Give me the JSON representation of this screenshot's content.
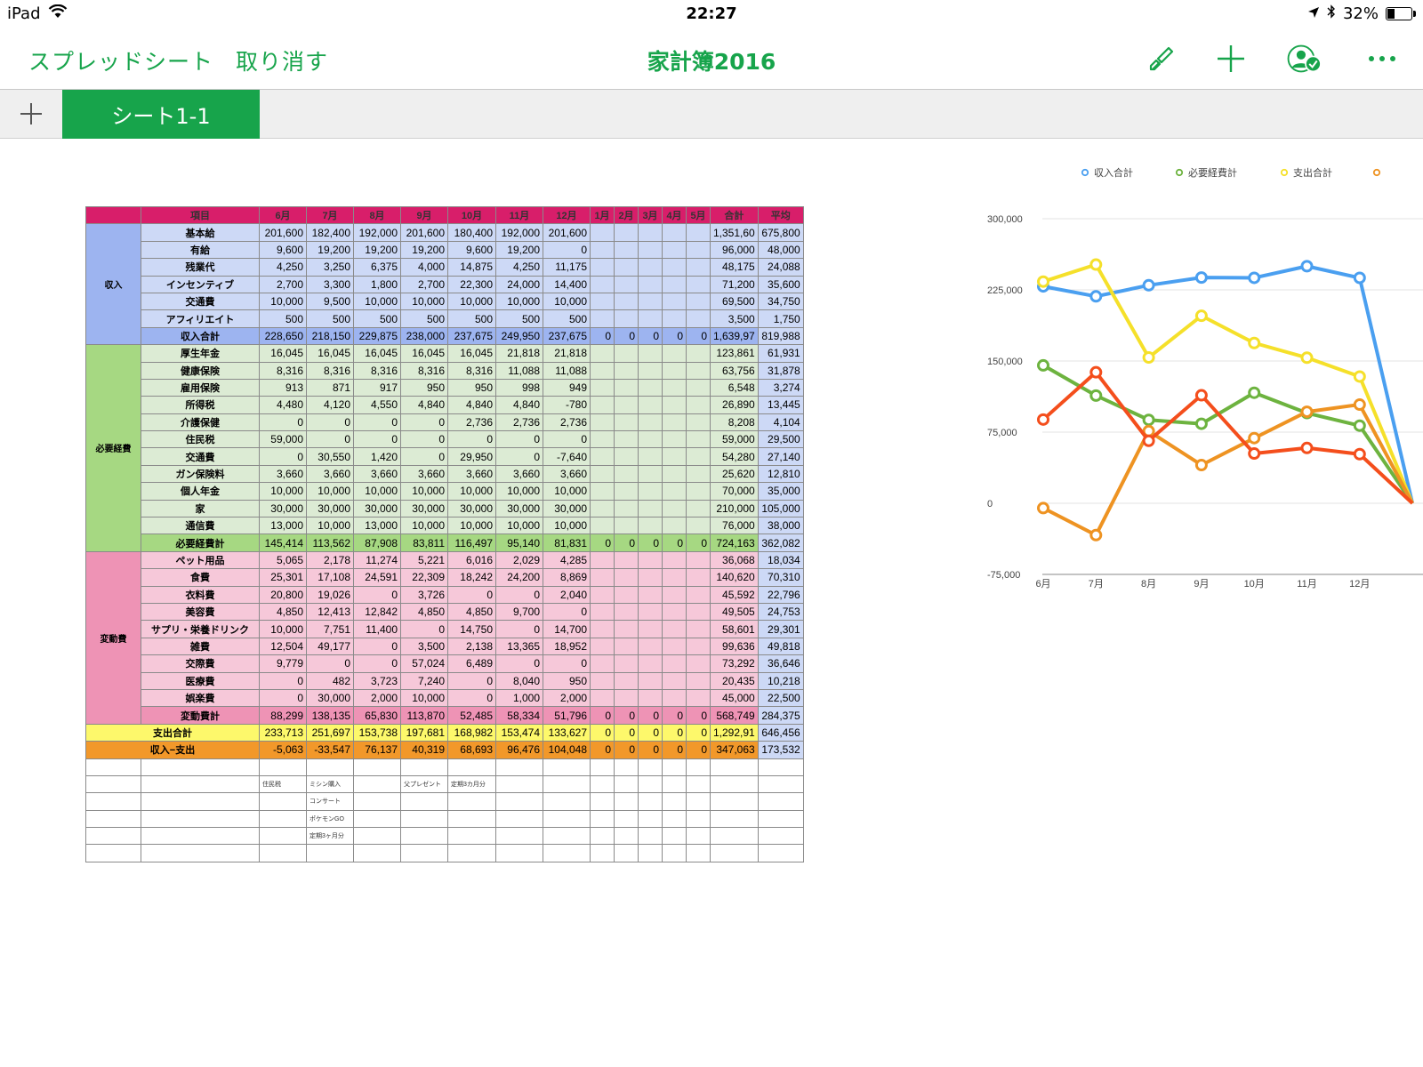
{
  "status": {
    "device": "iPad",
    "time": "22:27",
    "battery": "32%",
    "battery_level": 0.32
  },
  "toolbar": {
    "spreadsheets": "スプレッドシート",
    "undo": "取り消す",
    "title": "家計簿2016"
  },
  "tabs": [
    {
      "label": "シート1-1",
      "active": true
    }
  ],
  "sheet": {
    "headers": [
      "項目",
      "6月",
      "7月",
      "8月",
      "9月",
      "10月",
      "11月",
      "12月",
      "1月",
      "2月",
      "3月",
      "4月",
      "5月",
      "合計",
      "平均"
    ],
    "income": {
      "category": "収入",
      "rows": [
        {
          "label": "基本給",
          "values": [
            "201,600",
            "182,400",
            "192,000",
            "201,600",
            "180,400",
            "192,000",
            "201,600",
            "",
            "",
            "",
            "",
            "",
            "1,351,60",
            "675,800"
          ]
        },
        {
          "label": "有給",
          "values": [
            "9,600",
            "19,200",
            "19,200",
            "19,200",
            "9,600",
            "19,200",
            "0",
            "",
            "",
            "",
            "",
            "",
            "96,000",
            "48,000"
          ]
        },
        {
          "label": "残業代",
          "values": [
            "4,250",
            "3,250",
            "6,375",
            "4,000",
            "14,875",
            "4,250",
            "11,175",
            "",
            "",
            "",
            "",
            "",
            "48,175",
            "24,088"
          ]
        },
        {
          "label": "インセンティブ",
          "values": [
            "2,700",
            "3,300",
            "1,800",
            "2,700",
            "22,300",
            "24,000",
            "14,400",
            "",
            "",
            "",
            "",
            "",
            "71,200",
            "35,600"
          ]
        },
        {
          "label": "交通費",
          "values": [
            "10,000",
            "9,500",
            "10,000",
            "10,000",
            "10,000",
            "10,000",
            "10,000",
            "",
            "",
            "",
            "",
            "",
            "69,500",
            "34,750"
          ]
        },
        {
          "label": "アフィリエイト",
          "values": [
            "500",
            "500",
            "500",
            "500",
            "500",
            "500",
            "500",
            "",
            "",
            "",
            "",
            "",
            "3,500",
            "1,750"
          ]
        }
      ],
      "total": {
        "label": "収入合計",
        "values": [
          "228,650",
          "218,150",
          "229,875",
          "238,000",
          "237,675",
          "249,950",
          "237,675",
          "0",
          "0",
          "0",
          "0",
          "0",
          "1,639,97",
          "819,988"
        ]
      }
    },
    "necessary": {
      "category": "必要経費",
      "rows": [
        {
          "label": "厚生年金",
          "values": [
            "16,045",
            "16,045",
            "16,045",
            "16,045",
            "16,045",
            "21,818",
            "21,818",
            "",
            "",
            "",
            "",
            "",
            "123,861",
            "61,931"
          ]
        },
        {
          "label": "健康保険",
          "values": [
            "8,316",
            "8,316",
            "8,316",
            "8,316",
            "8,316",
            "11,088",
            "11,088",
            "",
            "",
            "",
            "",
            "",
            "63,756",
            "31,878"
          ]
        },
        {
          "label": "雇用保険",
          "values": [
            "913",
            "871",
            "917",
            "950",
            "950",
            "998",
            "949",
            "",
            "",
            "",
            "",
            "",
            "6,548",
            "3,274"
          ]
        },
        {
          "label": "所得税",
          "values": [
            "4,480",
            "4,120",
            "4,550",
            "4,840",
            "4,840",
            "4,840",
            "-780",
            "",
            "",
            "",
            "",
            "",
            "26,890",
            "13,445"
          ]
        },
        {
          "label": "介護保健",
          "values": [
            "0",
            "0",
            "0",
            "0",
            "2,736",
            "2,736",
            "2,736",
            "",
            "",
            "",
            "",
            "",
            "8,208",
            "4,104"
          ]
        },
        {
          "label": "住民税",
          "values": [
            "59,000",
            "0",
            "0",
            "0",
            "0",
            "0",
            "0",
            "",
            "",
            "",
            "",
            "",
            "59,000",
            "29,500"
          ]
        },
        {
          "label": "交通費",
          "values": [
            "0",
            "30,550",
            "1,420",
            "0",
            "29,950",
            "0",
            "-7,640",
            "",
            "",
            "",
            "",
            "",
            "54,280",
            "27,140"
          ]
        },
        {
          "label": "ガン保険料",
          "values": [
            "3,660",
            "3,660",
            "3,660",
            "3,660",
            "3,660",
            "3,660",
            "3,660",
            "",
            "",
            "",
            "",
            "",
            "25,620",
            "12,810"
          ]
        },
        {
          "label": "個人年金",
          "values": [
            "10,000",
            "10,000",
            "10,000",
            "10,000",
            "10,000",
            "10,000",
            "10,000",
            "",
            "",
            "",
            "",
            "",
            "70,000",
            "35,000"
          ]
        },
        {
          "label": "家",
          "values": [
            "30,000",
            "30,000",
            "30,000",
            "30,000",
            "30,000",
            "30,000",
            "30,000",
            "",
            "",
            "",
            "",
            "",
            "210,000",
            "105,000"
          ]
        },
        {
          "label": "通信費",
          "values": [
            "13,000",
            "10,000",
            "13,000",
            "10,000",
            "10,000",
            "10,000",
            "10,000",
            "",
            "",
            "",
            "",
            "",
            "76,000",
            "38,000"
          ]
        }
      ],
      "total": {
        "label": "必要経費計",
        "values": [
          "145,414",
          "113,562",
          "87,908",
          "83,811",
          "116,497",
          "95,140",
          "81,831",
          "0",
          "0",
          "0",
          "0",
          "0",
          "724,163",
          "362,082"
        ]
      }
    },
    "variable": {
      "category": "変動費",
      "rows": [
        {
          "label": "ペット用品",
          "values": [
            "5,065",
            "2,178",
            "11,274",
            "5,221",
            "6,016",
            "2,029",
            "4,285",
            "",
            "",
            "",
            "",
            "",
            "36,068",
            "18,034"
          ]
        },
        {
          "label": "食費",
          "values": [
            "25,301",
            "17,108",
            "24,591",
            "22,309",
            "18,242",
            "24,200",
            "8,869",
            "",
            "",
            "",
            "",
            "",
            "140,620",
            "70,310"
          ]
        },
        {
          "label": "衣料費",
          "values": [
            "20,800",
            "19,026",
            "0",
            "3,726",
            "0",
            "0",
            "2,040",
            "",
            "",
            "",
            "",
            "",
            "45,592",
            "22,796"
          ]
        },
        {
          "label": "美容費",
          "values": [
            "4,850",
            "12,413",
            "12,842",
            "4,850",
            "4,850",
            "9,700",
            "0",
            "",
            "",
            "",
            "",
            "",
            "49,505",
            "24,753"
          ]
        },
        {
          "label": "サプリ・栄養ドリンク",
          "values": [
            "10,000",
            "7,751",
            "11,400",
            "0",
            "14,750",
            "0",
            "14,700",
            "",
            "",
            "",
            "",
            "",
            "58,601",
            "29,301"
          ]
        },
        {
          "label": "雑費",
          "values": [
            "12,504",
            "49,177",
            "0",
            "3,500",
            "2,138",
            "13,365",
            "18,952",
            "",
            "",
            "",
            "",
            "",
            "99,636",
            "49,818"
          ]
        },
        {
          "label": "交際費",
          "values": [
            "9,779",
            "0",
            "0",
            "57,024",
            "6,489",
            "0",
            "0",
            "",
            "",
            "",
            "",
            "",
            "73,292",
            "36,646"
          ]
        },
        {
          "label": "医療費",
          "values": [
            "0",
            "482",
            "3,723",
            "7,240",
            "0",
            "8,040",
            "950",
            "",
            "",
            "",
            "",
            "",
            "20,435",
            "10,218"
          ]
        },
        {
          "label": "娯楽費",
          "values": [
            "0",
            "30,000",
            "2,000",
            "10,000",
            "0",
            "1,000",
            "2,000",
            "",
            "",
            "",
            "",
            "",
            "45,000",
            "22,500"
          ]
        }
      ],
      "total": {
        "label": "変動費計",
        "values": [
          "88,299",
          "138,135",
          "65,830",
          "113,870",
          "52,485",
          "58,334",
          "51,796",
          "0",
          "0",
          "0",
          "0",
          "0",
          "568,749",
          "284,375"
        ]
      }
    },
    "spend_total": {
      "label": "支出合計",
      "values": [
        "233,713",
        "251,697",
        "153,738",
        "197,681",
        "168,982",
        "153,474",
        "133,627",
        "0",
        "0",
        "0",
        "0",
        "0",
        "1,292,91",
        "646,456"
      ]
    },
    "net": {
      "label": "収入−支出",
      "values": [
        "-5,063",
        "-33,547",
        "76,137",
        "40,319",
        "68,693",
        "96,476",
        "104,048",
        "0",
        "0",
        "0",
        "0",
        "0",
        "347,063",
        "173,532"
      ]
    },
    "notes": [
      [
        "",
        "",
        "",
        "",
        "",
        "",
        ""
      ],
      [
        "住民税",
        "ミシン購入",
        "",
        "父プレゼント",
        "定期3カ月分",
        "",
        ""
      ],
      [
        "",
        "コンサート",
        "",
        "",
        "",
        "",
        ""
      ],
      [
        "",
        "ポケモンGO",
        "",
        "",
        "",
        "",
        ""
      ],
      [
        "",
        "定期3ヶ月分",
        "",
        "",
        "",
        "",
        ""
      ],
      [
        "",
        "",
        "",
        "",
        "",
        "",
        ""
      ]
    ]
  },
  "chart_data": {
    "type": "line",
    "categories": [
      "6月",
      "7月",
      "8月",
      "9月",
      "10月",
      "11月",
      "12月"
    ],
    "ylim": [
      -75000,
      300000
    ],
    "yticks": [
      "300,000",
      "225,000",
      "150,000",
      "75,000",
      "0",
      "-75,000"
    ],
    "legend_position": "top",
    "series": [
      {
        "name": "収入合計",
        "color": "#4a9ff0",
        "values": [
          228650,
          218150,
          229875,
          238000,
          237675,
          249950,
          237675
        ]
      },
      {
        "name": "必要経費計",
        "color": "#6db33f",
        "values": [
          145414,
          113562,
          87908,
          83811,
          116497,
          95140,
          81831
        ]
      },
      {
        "name": "支出合計",
        "color": "#f5e02a",
        "values": [
          233713,
          251697,
          153738,
          197681,
          168982,
          153474,
          133627
        ]
      },
      {
        "name": "",
        "color": "#ee9322",
        "values": [
          -5063,
          -33547,
          76137,
          40319,
          68693,
          96476,
          104048
        ]
      },
      {
        "name": "",
        "color": "#f44e1c",
        "values": [
          88299,
          138135,
          65830,
          113870,
          52485,
          58334,
          51796
        ]
      }
    ]
  }
}
